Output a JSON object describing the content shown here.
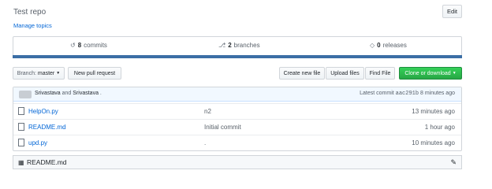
{
  "repo": {
    "description": "Test repo",
    "manage_topics": "Manage topics",
    "edit_label": "Edit"
  },
  "summary": {
    "commits_count": "8",
    "commits_label": "commits",
    "branches_count": "2",
    "branches_label": "branches",
    "releases_count": "0",
    "releases_label": "releases",
    "accent_color": "#3b6ea5"
  },
  "toolbar": {
    "branch_label": "Branch:",
    "branch_value": "master",
    "new_pull_request": "New pull request",
    "create_new_file": "Create new file",
    "upload_files": "Upload files",
    "find_file": "Find File",
    "clone_or_download": "Clone or download",
    "clone_color": "#28a745"
  },
  "latest_commit": {
    "author1": "Srivastava",
    "and": "and",
    "author2": "Srivastava",
    "message": ".",
    "label": "Latest commit",
    "sha": "aac291b",
    "age": "8 minutes ago"
  },
  "files": [
    {
      "name": "HelpOn.py",
      "message": "n2",
      "age": "13 minutes ago",
      "icon": "file-icon"
    },
    {
      "name": "README.md",
      "message": "Initial commit",
      "age": "1 hour ago",
      "icon": "file-icon"
    },
    {
      "name": "upd.py",
      "message": ".",
      "age": "10 minutes ago",
      "icon": "file-icon"
    }
  ],
  "readme": {
    "title": "README.md",
    "icon": "book-icon",
    "edit_icon": "pencil-icon"
  }
}
